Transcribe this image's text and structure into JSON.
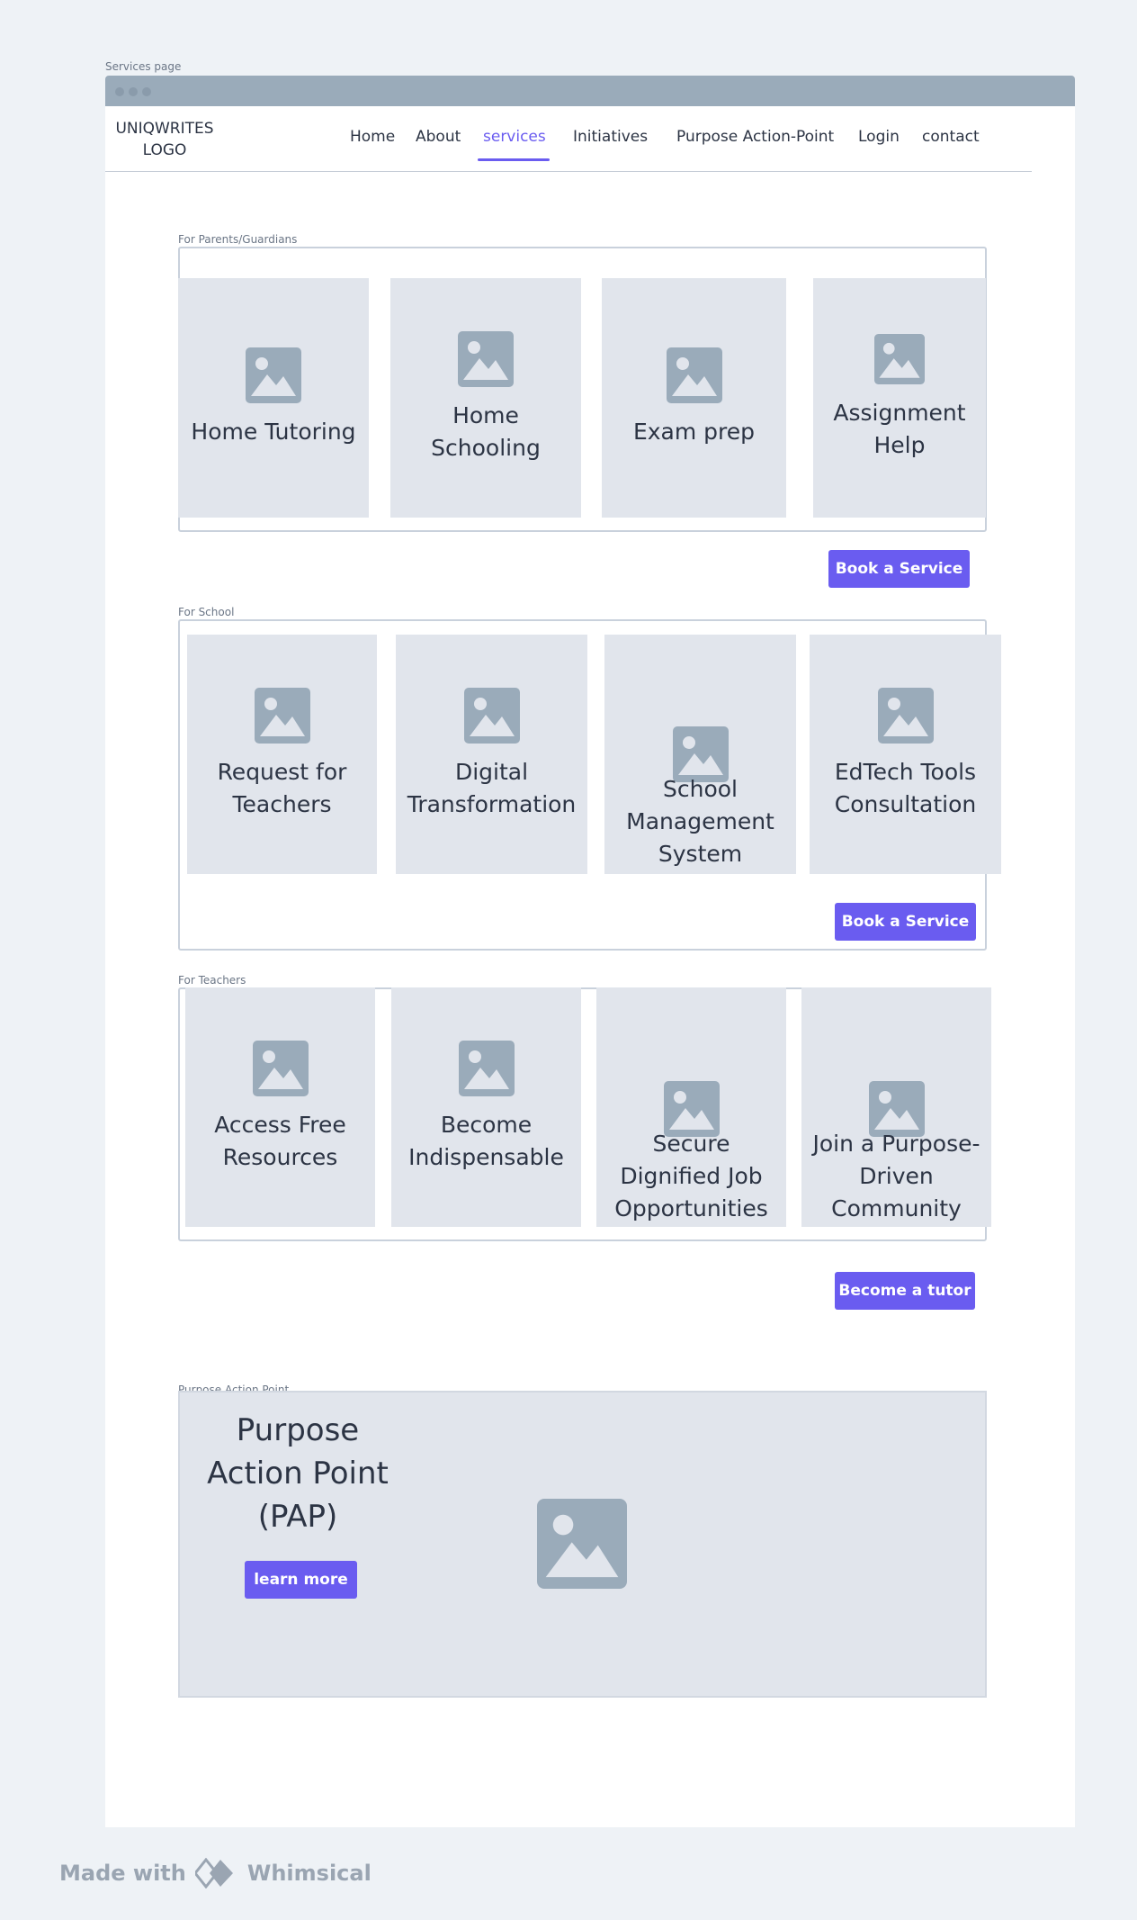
{
  "frame": {
    "title": "Services page"
  },
  "header": {
    "logo_line1": "UNIQWRITES",
    "logo_line2": "LOGO",
    "nav": [
      {
        "label": "Home",
        "active": false
      },
      {
        "label": "About",
        "active": false
      },
      {
        "label": "services",
        "active": true
      },
      {
        "label": "Initiatives",
        "active": false
      },
      {
        "label": "Purpose Action-Point",
        "active": false
      },
      {
        "label": "Login",
        "active": false
      },
      {
        "label": "contact",
        "active": false
      }
    ]
  },
  "parents": {
    "label": "For Parents/Guardians",
    "cards": [
      {
        "title": "Home Tutoring",
        "icon": "image-placeholder-icon"
      },
      {
        "title": "Home Schooling",
        "icon": "image-placeholder-icon"
      },
      {
        "title": "Exam prep",
        "icon": "image-placeholder-icon"
      },
      {
        "title": "Assignment Help",
        "icon": "image-placeholder-icon"
      }
    ],
    "button": "Book a Service"
  },
  "school": {
    "label": "For School",
    "cards": [
      {
        "title": "Request for Teachers",
        "icon": "image-placeholder-icon"
      },
      {
        "title": "Digital Transformation",
        "icon": "image-placeholder-icon"
      },
      {
        "title": "School Management System",
        "icon": "image-placeholder-icon"
      },
      {
        "title": "EdTech Tools Consultation",
        "icon": "image-placeholder-icon"
      }
    ],
    "button": "Book a Service"
  },
  "teachers": {
    "label": "For Teachers",
    "cards": [
      {
        "title": "Access Free Resources",
        "icon": "image-placeholder-icon"
      },
      {
        "title": "Become Indispensable",
        "icon": "image-placeholder-icon"
      },
      {
        "title": "Secure Dignified Job Opportunities",
        "icon": "image-placeholder-icon"
      },
      {
        "title": "Join a Purpose-Driven Community",
        "icon": "image-placeholder-icon"
      }
    ],
    "button": "Become a tutor"
  },
  "pap": {
    "label": "Purpose Action Point",
    "title": "Purpose Action Point (PAP)",
    "button": "learn more"
  },
  "footer": {
    "made_with": "Made with",
    "brand": "Whimsical"
  },
  "colors": {
    "accent": "#6a5cf0",
    "placeholder": "#9aabba",
    "card_bg": "#e1e5ec",
    "page_bg": "#eef2f6"
  }
}
